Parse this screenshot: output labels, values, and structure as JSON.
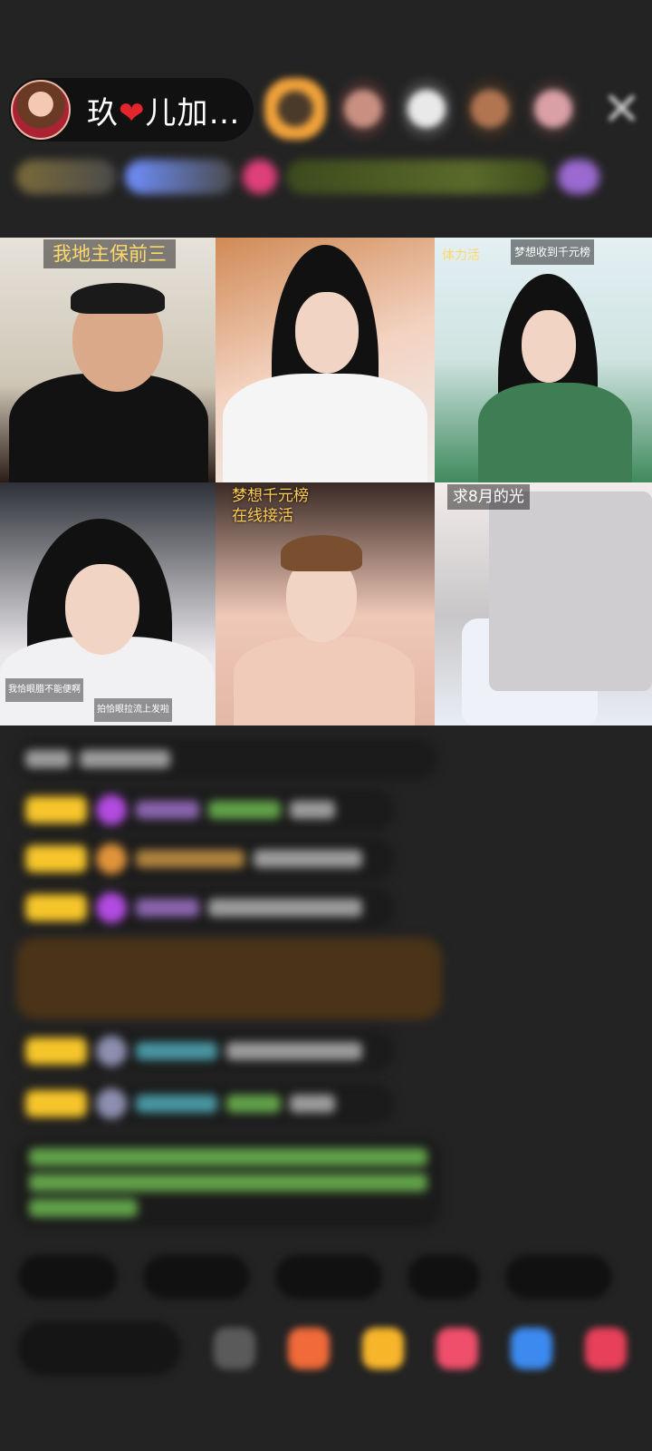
{
  "host": {
    "name_prefix": "玖",
    "heart": "❤",
    "name_suffix": "儿加…"
  },
  "icons": {
    "close": "close-icon",
    "heart": "heart-icon"
  },
  "video_grid": {
    "cells": [
      {
        "label": "我地主保前三"
      },
      {
        "label": ""
      },
      {
        "label": "梦想收到千元榜",
        "sub_label": "体力活"
      },
      {
        "label": "",
        "overlay_left": "我恰眼腊不能便啊",
        "overlay_right": "拍恰眼拉流上发啦"
      },
      {
        "label_line1": "梦想千元榜",
        "label_line2": "在线接活"
      },
      {
        "label": "求8月的光"
      }
    ]
  },
  "colors": {
    "background": "#232323",
    "badge_gold": "#f6c52a",
    "heart_red": "#e3262c",
    "label_yellow": "#ffd86a"
  }
}
